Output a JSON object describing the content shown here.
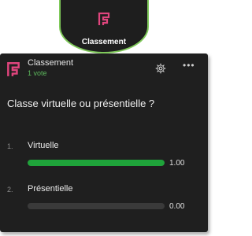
{
  "badge": {
    "label": "Classement",
    "icon": "poll-logo-icon"
  },
  "poll": {
    "title": "Classement",
    "votes": "1 vote",
    "question": "Classe virtuelle ou présentielle ?",
    "options": [
      {
        "number": "1.",
        "label": "Virtuelle",
        "value_text": "1.00",
        "fill": 1.0
      },
      {
        "number": "2.",
        "label": "Présentielle",
        "value_text": "0.00",
        "fill": 0.0
      }
    ]
  },
  "colors": {
    "accent": "#e83e8c",
    "bar": "#1fa33a",
    "vote_text": "#5cb85c"
  }
}
